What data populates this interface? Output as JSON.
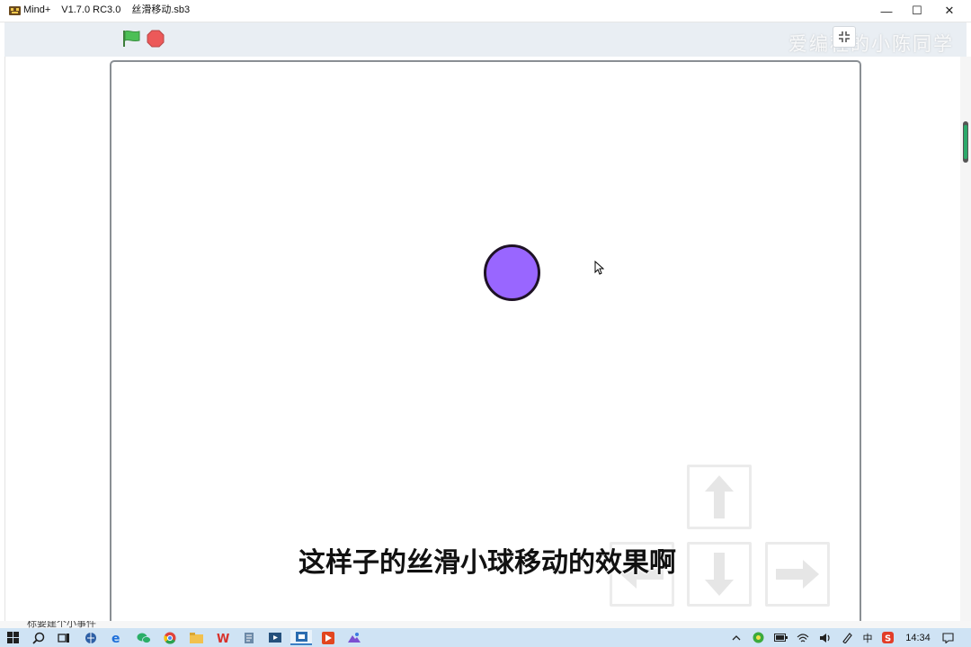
{
  "window": {
    "app_name": "Mind+",
    "version": "V1.7.0 RC3.0",
    "file_name": "丝滑移动.sb3",
    "minimize_glyph": "—",
    "maximize_glyph": "☐",
    "close_glyph": "✕"
  },
  "toolbar": {
    "flag_icon": "green-flag-icon",
    "stop_icon": "stop-icon",
    "exit_fullscreen_icon": "exit-fullscreen-icon",
    "watermark": "爱编程的小陈同学"
  },
  "stage": {
    "sprite": {
      "name": "ball",
      "color": "#9966ff",
      "outline": "#1e1226"
    },
    "subtitle": "这样子的丝滑小球移动的效果啊",
    "arrow_keys": [
      {
        "name": "up",
        "glyph": "↑"
      },
      {
        "name": "left",
        "glyph": "←"
      },
      {
        "name": "down",
        "glyph": "↓"
      },
      {
        "name": "right",
        "glyph": "→"
      }
    ]
  },
  "bottom_strip_text": "标要建个小事件",
  "taskbar": {
    "apps": [
      "start-icon",
      "search-icon",
      "task-view-icon",
      "browser-icon",
      "edge-icon",
      "wechat-icon",
      "chrome-icon",
      "file-explorer-icon",
      "wps-icon",
      "notepad-icon",
      "media-icon",
      "mindplus-icon",
      "video-editor-icon",
      "photos-icon"
    ],
    "ime": "中",
    "clock": "14:34"
  }
}
